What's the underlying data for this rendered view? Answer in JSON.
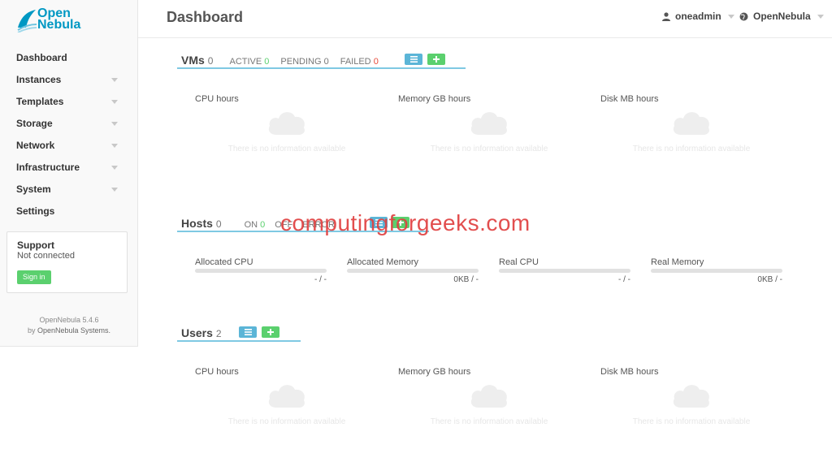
{
  "app": {
    "logo_line1": "Open",
    "logo_line2": "Nebula",
    "page_title": "Dashboard",
    "user": "oneadmin",
    "zone": "OpenNebula"
  },
  "sidebar": {
    "items": [
      {
        "label": "Dashboard"
      },
      {
        "label": "Instances"
      },
      {
        "label": "Templates"
      },
      {
        "label": "Storage"
      },
      {
        "label": "Network"
      },
      {
        "label": "Infrastructure"
      },
      {
        "label": "System"
      },
      {
        "label": "Settings"
      }
    ],
    "support": {
      "title": "Support",
      "status": "Not connected",
      "signin_label": "Sign in"
    },
    "version_line1": "OpenNebula 5.4.6",
    "version_line2_prefix": "by",
    "version_line2_link": "OpenNebula Systems."
  },
  "vms": {
    "title": "VMs",
    "count": "0",
    "active_label": "ACTIVE",
    "active_value": "0",
    "pending_label": "PENDING",
    "pending_value": "0",
    "failed_label": "FAILED",
    "failed_value": "0",
    "list_icon": "list-icon",
    "add_icon": "plus-icon",
    "widgets": [
      {
        "label": "CPU hours",
        "empty": "There is no information available"
      },
      {
        "label": "Memory GB hours",
        "empty": "There is no information available"
      },
      {
        "label": "Disk MB hours",
        "empty": "There is no information available"
      }
    ]
  },
  "hosts": {
    "title": "Hosts",
    "count": "0",
    "on_label": "ON",
    "on_value": "0",
    "off_label": "OFF",
    "error_label": "ERROR",
    "bars": [
      {
        "label": "Allocated CPU",
        "value": "- / -"
      },
      {
        "label": "Allocated Memory",
        "value": "0KB / -"
      },
      {
        "label": "Real CPU",
        "value": "- / -"
      },
      {
        "label": "Real Memory",
        "value": "0KB / -"
      }
    ]
  },
  "users": {
    "title": "Users",
    "count": "2",
    "widgets": [
      {
        "label": "CPU hours",
        "empty": "There is no information available"
      },
      {
        "label": "Memory GB hours",
        "empty": "There is no information available"
      },
      {
        "label": "Disk MB hours",
        "empty": "There is no information available"
      }
    ]
  },
  "watermark": "computingforgeeks.com",
  "colors": {
    "accent": "#0098c3",
    "green": "#5bd06e",
    "red": "#e74c3c",
    "blue_button": "#5bb5d7"
  }
}
